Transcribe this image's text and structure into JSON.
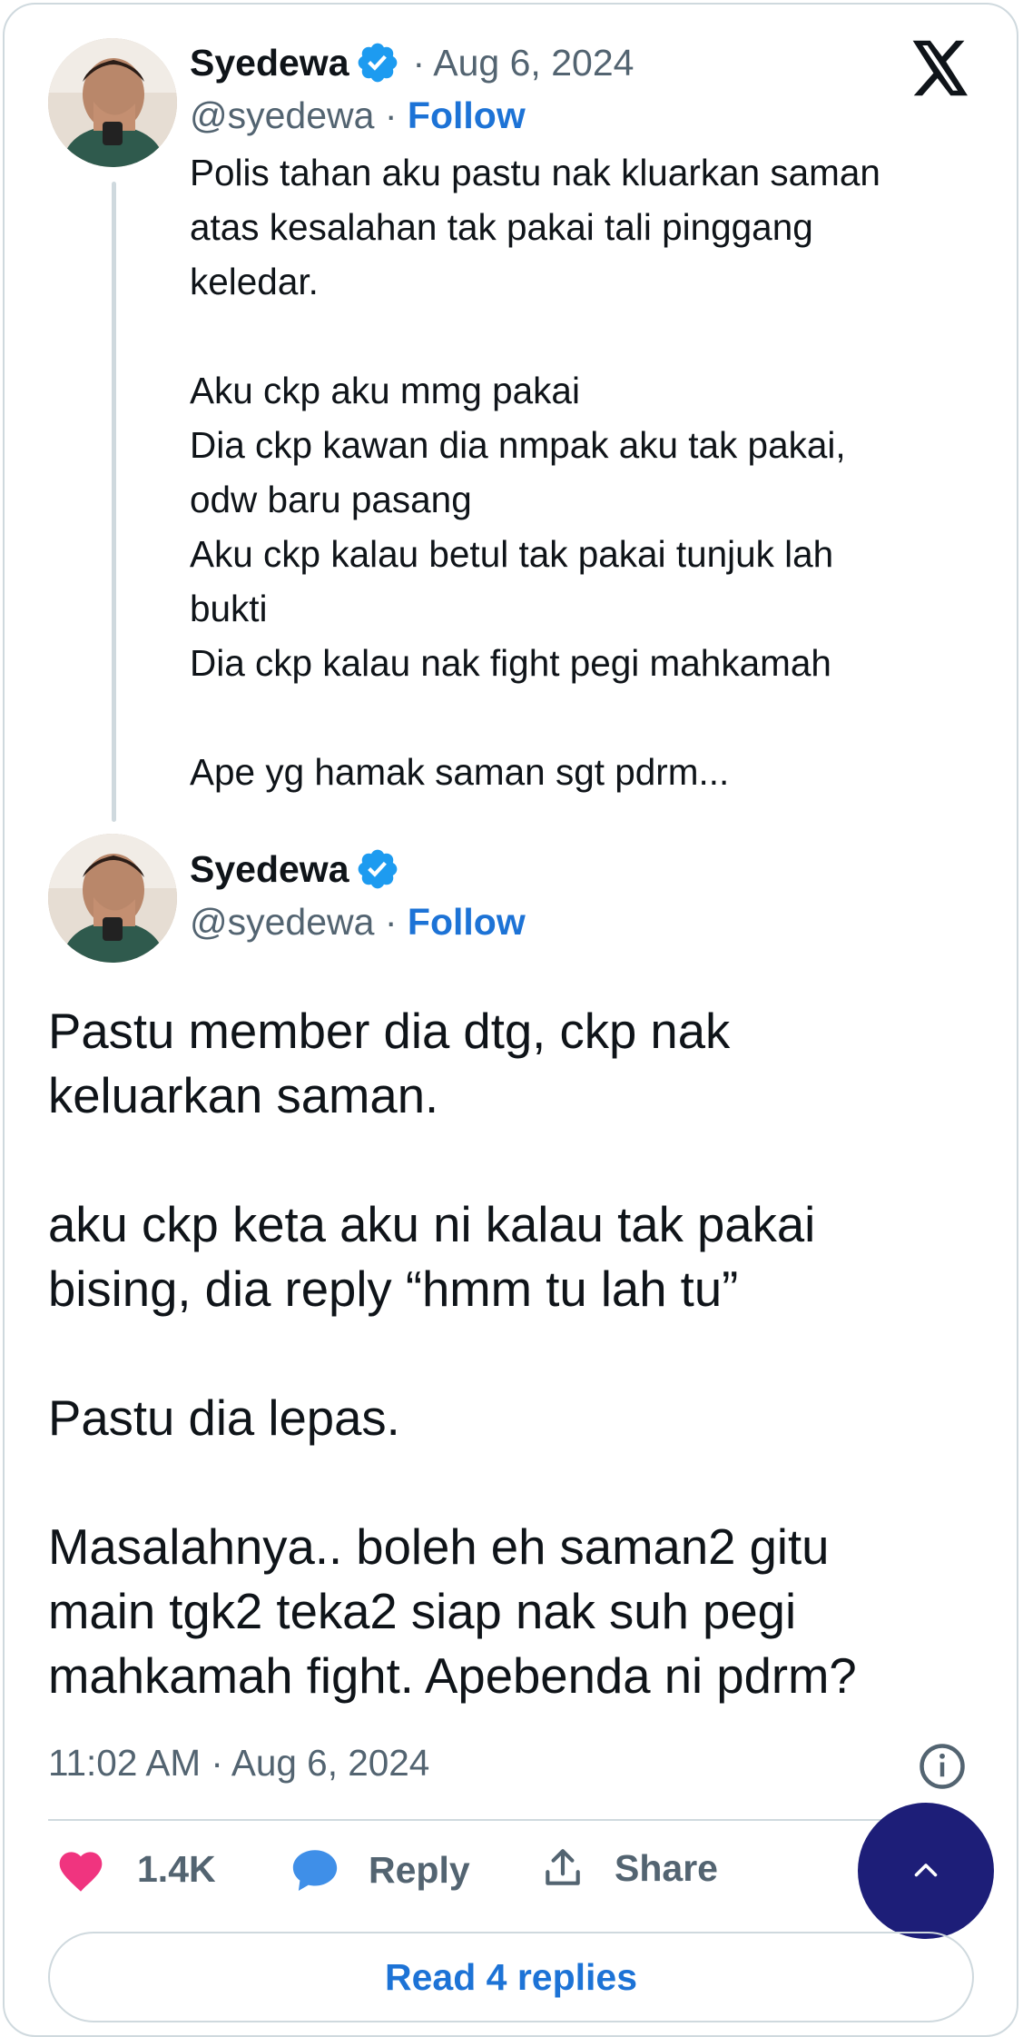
{
  "brand": {
    "x_logo": "x-logo",
    "accent_color": "#1d73d6",
    "like_color": "#f0347f",
    "reply_color": "#3f8fe8"
  },
  "quoted_tweet": {
    "author_name": "Syedewa",
    "verified": true,
    "date": "· Aug 6, 2024",
    "handle": "@syedewa",
    "separator": "·",
    "follow_label": "Follow",
    "text": "Polis tahan aku pastu nak kluarkan saman\natas kesalahan tak pakai tali pinggang\nkeledar.\n\nAku ckp aku mmg pakai\nDia ckp kawan dia nmpak aku tak pakai,\nodw baru pasang\nAku ckp kalau betul tak pakai tunjuk lah\nbukti\nDia ckp kalau nak fight pegi mahkamah\n\nApe yg hamak saman sgt pdrm..."
  },
  "main_tweet": {
    "author_name": "Syedewa",
    "verified": true,
    "handle": "@syedewa",
    "separator": "·",
    "follow_label": "Follow",
    "text": "Pastu member dia dtg, ckp nak\nkeluarkan saman.\n\naku ckp keta aku ni kalau tak pakai\nbising, dia reply “hmm tu lah tu”\n\nPastu dia lepas.\n\nMasalahnya.. boleh eh saman2 gitu\nmain tgk2 teka2 siap nak suh pegi\nmahkamah fight. Apebenda ni pdrm?",
    "timestamp": "11:02 AM · Aug 6, 2024"
  },
  "actions": {
    "like_count": "1.4K",
    "reply_label": "Reply",
    "share_label": "Share"
  },
  "read_replies_label": "Read 4 replies"
}
